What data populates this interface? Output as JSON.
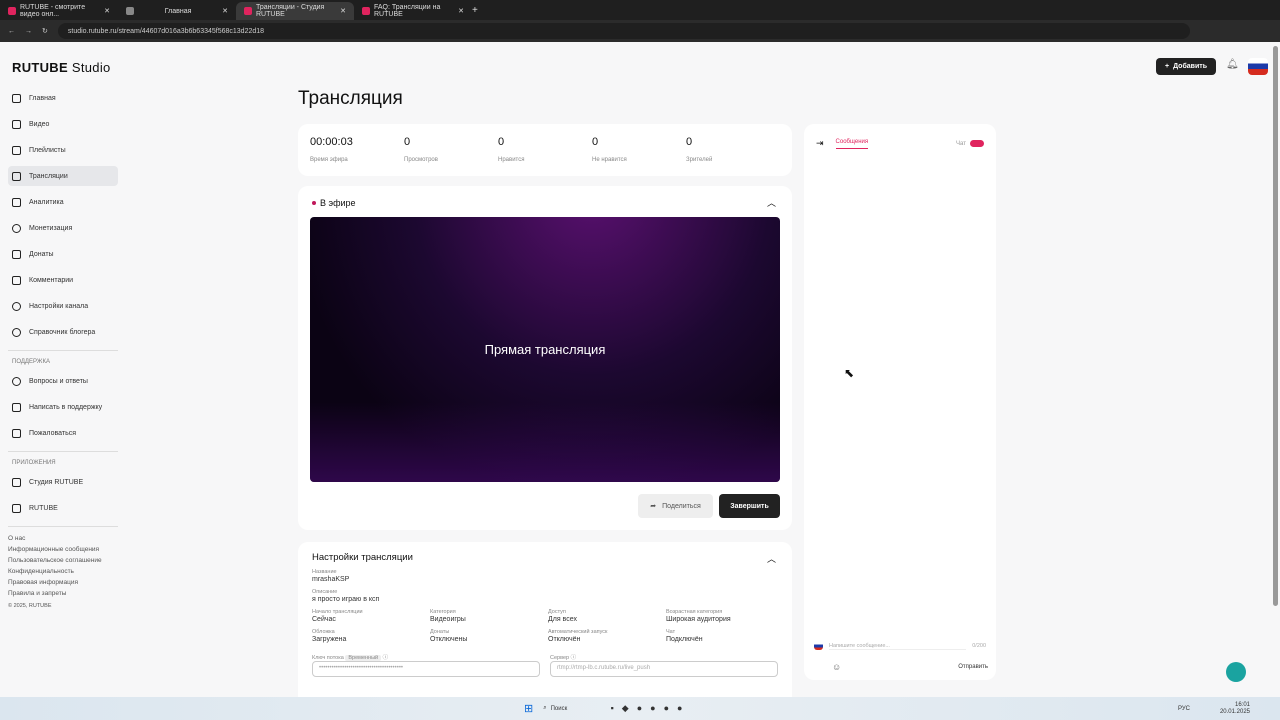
{
  "browser": {
    "tabs": [
      "RUTUBE - смотрите видео онл...",
      "Главная",
      "Трансляции - Студия RUTUBE",
      "FAQ: Трансляции на RUTUBE"
    ],
    "url": "studio.rutube.ru/stream/44607d016a3b6b63345f568c13d22d18"
  },
  "header": {
    "logo": "RUTUBE",
    "logo_suffix": "Studio",
    "add_label": "Добавить"
  },
  "sidebar": {
    "items": [
      "Главная",
      "Видео",
      "Плейлисты",
      "Трансляции",
      "Аналитика",
      "Монетизация",
      "Донаты",
      "Комментарии",
      "Настройки канала",
      "Справочник блогера"
    ],
    "support_title": "ПОДДЕРЖКА",
    "support": [
      "Вопросы и ответы",
      "Написать в поддержку",
      "Пожаловаться"
    ],
    "apps_title": "ПРИЛОЖЕНИЯ",
    "apps": [
      "Студия RUTUBE",
      "RUTUBE"
    ],
    "footer": [
      "О нас",
      "Информационные сообщения",
      "Пользовательское соглашение",
      "Конфиденциальность",
      "Правовая информация",
      "Правила и запреты"
    ],
    "copyright": "© 2025, RUTUBE"
  },
  "page": {
    "title": "Трансляция"
  },
  "stats": [
    {
      "value": "00:00:03",
      "label": "Время эфира"
    },
    {
      "value": "0",
      "label": "Просмотров"
    },
    {
      "value": "0",
      "label": "Нравится"
    },
    {
      "value": "0",
      "label": "Не нравится"
    },
    {
      "value": "0",
      "label": "Зрителей"
    }
  ],
  "live": {
    "status": "В эфире",
    "video_text": "Прямая трансляция",
    "share": "Поделиться",
    "finish": "Завершить"
  },
  "settings": {
    "title": "Настройки трансляции",
    "name_label": "Название",
    "name": "mrashaKSP",
    "desc_label": "Описание",
    "desc": "я просто играю в ксп",
    "fields": [
      {
        "label": "Начало трансляции",
        "value": "Сейчас"
      },
      {
        "label": "Категория",
        "value": "Видеоигры"
      },
      {
        "label": "Доступ",
        "value": "Для всех"
      },
      {
        "label": "Возрастная категория",
        "value": "Широкая аудитория"
      },
      {
        "label": "Обложка",
        "value": "Загружена"
      },
      {
        "label": "Донаты",
        "value": "Отключены"
      },
      {
        "label": "Автоматический запуск",
        "value": "Отключён"
      },
      {
        "label": "Чат",
        "value": "Подключён"
      }
    ],
    "key_label": "Ключ потока",
    "key_badge": "Временный",
    "server_label": "Сервер",
    "key_value": "••••••••••••••••••••••••••••••••••••••••",
    "server_value": "rtmp://rtmp-lb.c.rutube.ru/live_push"
  },
  "chat": {
    "tab": "Сообщения",
    "toggle_label": "Чат",
    "placeholder": "Напишите сообщение...",
    "counter": "0/200",
    "send": "Отправить"
  },
  "taskbar": {
    "search": "Поиск",
    "lang": "РУС",
    "time": "16:01",
    "date": "20.01.2025"
  }
}
